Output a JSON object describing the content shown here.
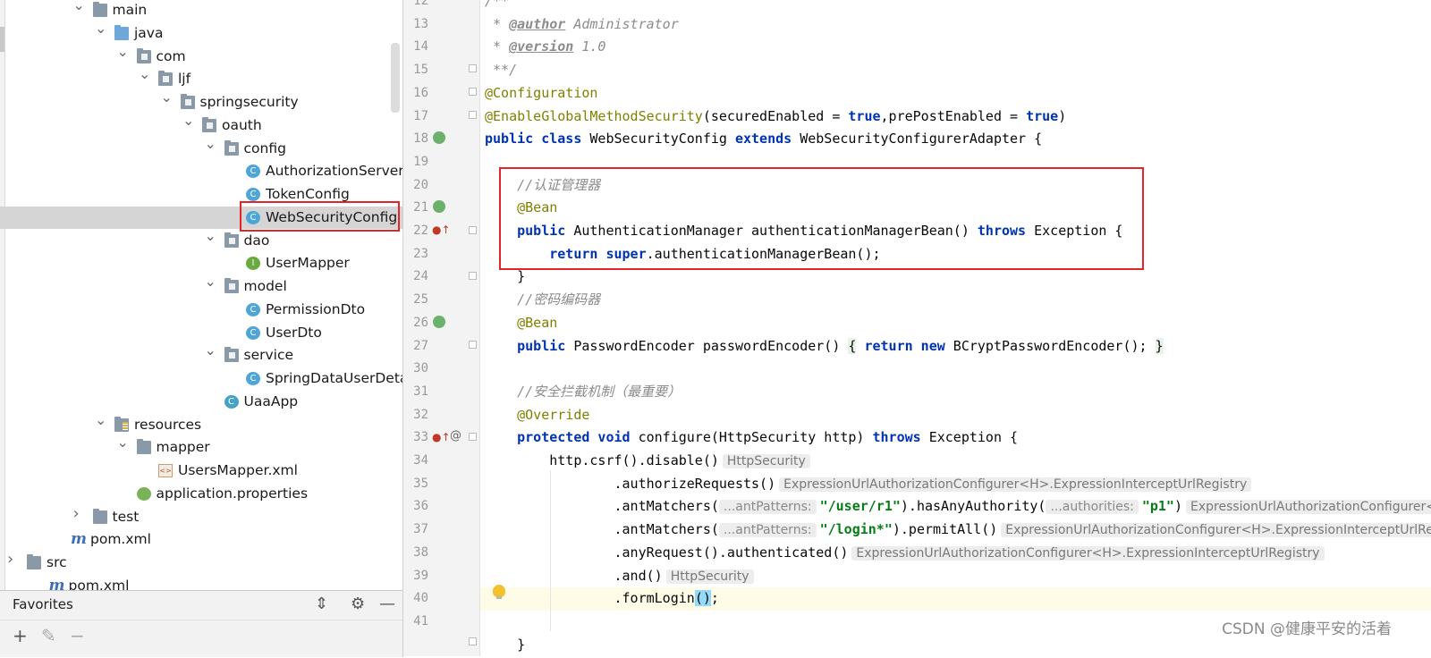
{
  "project_tree": {
    "items": [
      {
        "label": "main",
        "indent": 4,
        "type": "folder",
        "arrow": "v"
      },
      {
        "label": "java",
        "indent": 5,
        "type": "src-folder",
        "arrow": "v"
      },
      {
        "label": "com",
        "indent": 6,
        "type": "package",
        "arrow": "v"
      },
      {
        "label": "ljf",
        "indent": 7,
        "type": "package",
        "arrow": "v"
      },
      {
        "label": "springsecurity",
        "indent": 8,
        "type": "package",
        "arrow": "v"
      },
      {
        "label": "oauth",
        "indent": 9,
        "type": "package",
        "arrow": "v"
      },
      {
        "label": "config",
        "indent": 10,
        "type": "package",
        "arrow": "v"
      },
      {
        "label": "AuthorizationServer",
        "indent": 11,
        "type": "class",
        "arrow": ""
      },
      {
        "label": "TokenConfig",
        "indent": 11,
        "type": "class",
        "arrow": ""
      },
      {
        "label": "WebSecurityConfig",
        "indent": 11,
        "type": "class",
        "arrow": "",
        "selected": true
      },
      {
        "label": "dao",
        "indent": 10,
        "type": "package",
        "arrow": "v"
      },
      {
        "label": "UserMapper",
        "indent": 11,
        "type": "interface",
        "arrow": ""
      },
      {
        "label": "model",
        "indent": 10,
        "type": "package",
        "arrow": "v"
      },
      {
        "label": "PermissionDto",
        "indent": 11,
        "type": "class",
        "arrow": ""
      },
      {
        "label": "UserDto",
        "indent": 11,
        "type": "class",
        "arrow": ""
      },
      {
        "label": "service",
        "indent": 10,
        "type": "package",
        "arrow": "v"
      },
      {
        "label": "SpringDataUserDetai",
        "indent": 11,
        "type": "class",
        "arrow": ""
      },
      {
        "label": "UaaApp",
        "indent": 10,
        "type": "app-class",
        "arrow": ""
      },
      {
        "label": "resources",
        "indent": 5,
        "type": "res-folder",
        "arrow": "v"
      },
      {
        "label": "mapper",
        "indent": 6,
        "type": "folder",
        "arrow": "v"
      },
      {
        "label": "UsersMapper.xml",
        "indent": 7,
        "type": "xml",
        "arrow": ""
      },
      {
        "label": "application.properties",
        "indent": 6,
        "type": "properties",
        "arrow": ""
      },
      {
        "label": "test",
        "indent": 4,
        "type": "folder",
        "arrow": ">"
      },
      {
        "label": "pom.xml",
        "indent": 3,
        "type": "maven",
        "arrow": ""
      },
      {
        "label": "src",
        "indent": 1,
        "type": "folder",
        "arrow": ">"
      },
      {
        "label": "pom.xml",
        "indent": 2,
        "type": "maven",
        "arrow": ""
      }
    ]
  },
  "icons": {
    "class": "C",
    "interface": "I",
    "xml": "<>"
  },
  "favorites": {
    "title": "Favorites",
    "tools": {
      "collapse": "⇕",
      "settings": "⚙",
      "hide": "—"
    },
    "buttons": {
      "add": "+",
      "edit": "✎",
      "remove": "−"
    }
  },
  "gutter": {
    "line_numbers": [
      "12",
      "13",
      "14",
      "15",
      "16",
      "17",
      "18",
      "19",
      "20",
      "21",
      "22",
      "23",
      "24",
      "25",
      "26",
      "27",
      "30",
      "31",
      "32",
      "33",
      "34",
      "35",
      "36",
      "37",
      "38",
      "39",
      "40",
      "41"
    ]
  },
  "editor": {
    "lines": [
      {
        "n": "12",
        "html": "<span class=\"cmt\">/**</span>"
      },
      {
        "n": "13",
        "html": "<span class=\"cmt\"> * </span><span class=\"tag\">@author</span><span class=\"cmt\"> Administrator</span>"
      },
      {
        "n": "14",
        "html": "<span class=\"cmt\"> * </span><span class=\"tag\">@version</span><span class=\"cmt\"> 1.0</span>"
      },
      {
        "n": "15",
        "html": "<span class=\"cmt\"> **/</span>"
      },
      {
        "n": "16",
        "html": "<span class=\"ann\">@Configuration</span>"
      },
      {
        "n": "17",
        "html": "<span class=\"ann\">@EnableGlobalMethodSecurity</span>(securedEnabled = <span class=\"kw\">true</span>,prePostEnabled = <span class=\"kw\">true</span>)"
      },
      {
        "n": "18",
        "html": "<span class=\"kw\">public class</span> WebSecurityConfig <span class=\"kw\">extends</span> WebSecurityConfigurerAdapter {"
      },
      {
        "n": "19",
        "html": ""
      },
      {
        "n": "20",
        "html": "    <span class=\"cmt\">//认证管理器</span>"
      },
      {
        "n": "21",
        "html": "    <span class=\"ann\">@Bean</span>"
      },
      {
        "n": "22",
        "html": "    <span class=\"kw\">public</span> AuthenticationManager authenticationManagerBean() <span class=\"kw\">throws</span> Exception {"
      },
      {
        "n": "23",
        "html": "        <span class=\"kw\">return super</span>.authenticationManagerBean();"
      },
      {
        "n": "24",
        "html": "    }"
      },
      {
        "n": "25",
        "html": "    <span class=\"cmt\">//密码编码器</span>"
      },
      {
        "n": "26",
        "html": "    <span class=\"ann\">@Bean</span>"
      },
      {
        "n": "27",
        "html": "    <span class=\"kw\">public</span> PasswordEncoder passwordEncoder() <span class=\"brace-hl\">{</span> <span class=\"kw\">return new</span> BCryptPasswordEncoder(); <span class=\"brace-hl\">}</span>"
      },
      {
        "n": "30",
        "html": ""
      },
      {
        "n": "31",
        "html": "    <span class=\"cmt\">//安全拦截机制（最重要）</span>"
      },
      {
        "n": "32",
        "html": "    <span class=\"ann\">@Override</span>"
      },
      {
        "n": "33",
        "html": "    <span class=\"kw\">protected void</span> configure(HttpSecurity http) <span class=\"kw\">throws</span> Exception {"
      },
      {
        "n": "34",
        "html": "        http.csrf().disable()<span class=\"hint\">HttpSecurity</span>"
      },
      {
        "n": "35",
        "html": "                .authorizeRequests()<span class=\"hint\">ExpressionUrlAuthorizationConfigurer&lt;H&gt;.ExpressionInterceptUrlRegistry</span>"
      },
      {
        "n": "36",
        "html": "                .antMatchers(<span class=\"hint param\">...antPatterns:</span><span class=\"str\">\"/user/r1\"</span>).hasAnyAuthority(<span class=\"hint param\">...authorities:</span><span class=\"str\">\"p1\"</span>)<span class=\"hint\">ExpressionUrlAuthorizationConfigurer&lt;H&gt;.ExpressionInterceptUrlRegistry</span>"
      },
      {
        "n": "37",
        "html": "                .antMatchers(<span class=\"hint param\">...antPatterns:</span><span class=\"str\">\"/login*\"</span>).permitAll()<span class=\"hint\">ExpressionUrlAuthorizationConfigurer&lt;H&gt;.ExpressionInterceptUrlRegistry</span>"
      },
      {
        "n": "38",
        "html": "                .anyRequest().authenticated()<span class=\"hint\">ExpressionUrlAuthorizationConfigurer&lt;H&gt;.ExpressionInterceptUrlRegistry</span>"
      },
      {
        "n": "39",
        "html": "                .and()<span class=\"hint\">HttpSecurity</span>"
      },
      {
        "n": "40",
        "html": "                .formLogin<span class=\"paren-hl\">()</span>;",
        "current": true
      },
      {
        "n": "41",
        "html": ""
      },
      {
        "n": "",
        "html": "    }"
      }
    ]
  },
  "watermark": "CSDN @健康平安的活着",
  "colors": {
    "highlight_box": "#e0262a",
    "keyword": "#0033b3",
    "annotation": "#808000",
    "string": "#067d17",
    "comment": "#8c8c8c"
  }
}
